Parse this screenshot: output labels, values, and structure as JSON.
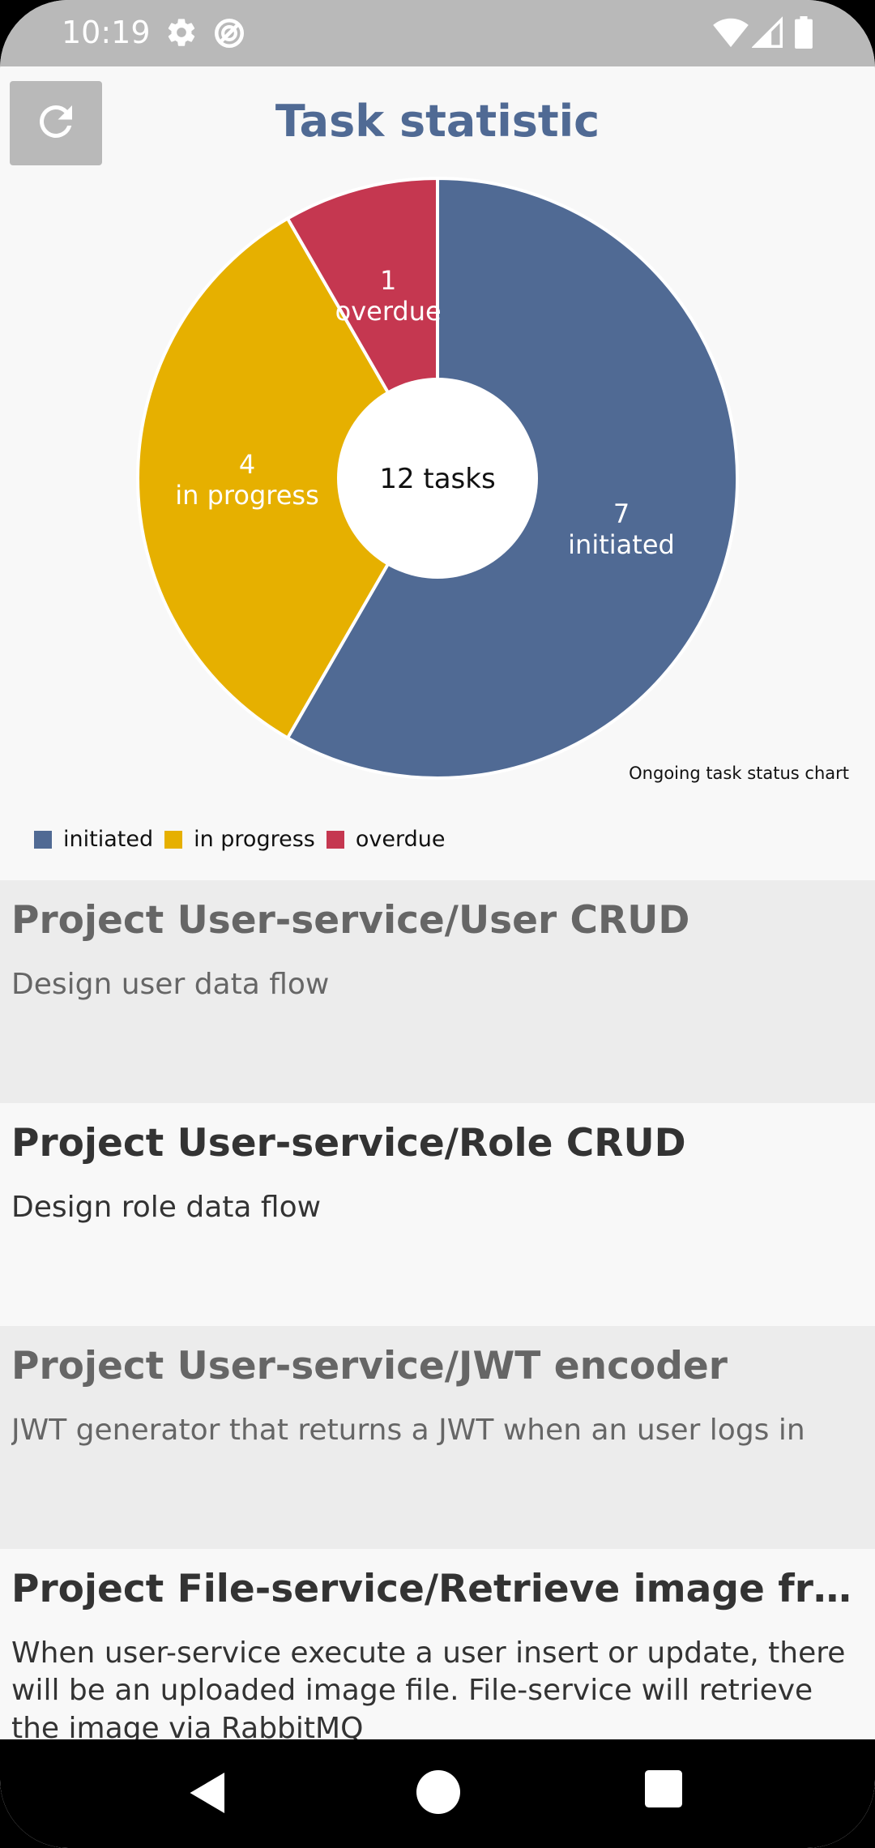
{
  "status_bar": {
    "time": "10:19",
    "icons": [
      "gear-icon",
      "do-not-disturb-icon",
      "wifi-icon",
      "signal-icon",
      "battery-icon"
    ]
  },
  "header": {
    "title": "Task statistic",
    "refresh_icon": "refresh-icon"
  },
  "chart_data": {
    "type": "pie",
    "title": "Task statistic",
    "center_label": "12 tasks",
    "caption": "Ongoing task status chart",
    "categories": [
      "initiated",
      "in progress",
      "overdue"
    ],
    "values": [
      7,
      4,
      1
    ],
    "slice_labels": [
      "initiated",
      "in progress",
      "overdue"
    ],
    "colors": [
      "#506a94",
      "#e6b000",
      "#c53750"
    ],
    "legend_position": "bottom-left"
  },
  "legend": [
    {
      "label": "initiated",
      "color": "#506a94"
    },
    {
      "label": "in progress",
      "color": "#e6b000"
    },
    {
      "label": "overdue",
      "color": "#c53750"
    }
  ],
  "tasks": [
    {
      "title": "Project User-service/User CRUD",
      "description": "Design user data flow"
    },
    {
      "title": "Project User-service/Role CRUD",
      "description": "Design role data flow"
    },
    {
      "title": "Project User-service/JWT encoder",
      "description": "JWT generator that returns a JWT when an user logs in"
    },
    {
      "title": "Project File-service/Retrieve image from User-service",
      "description": "When user-service execute a user insert or update, there will be an uploaded image file. File-service will retrieve the image via RabbitMQ"
    }
  ],
  "nav_bar": {
    "icons": [
      "back-icon",
      "home-icon",
      "recents-icon"
    ]
  }
}
